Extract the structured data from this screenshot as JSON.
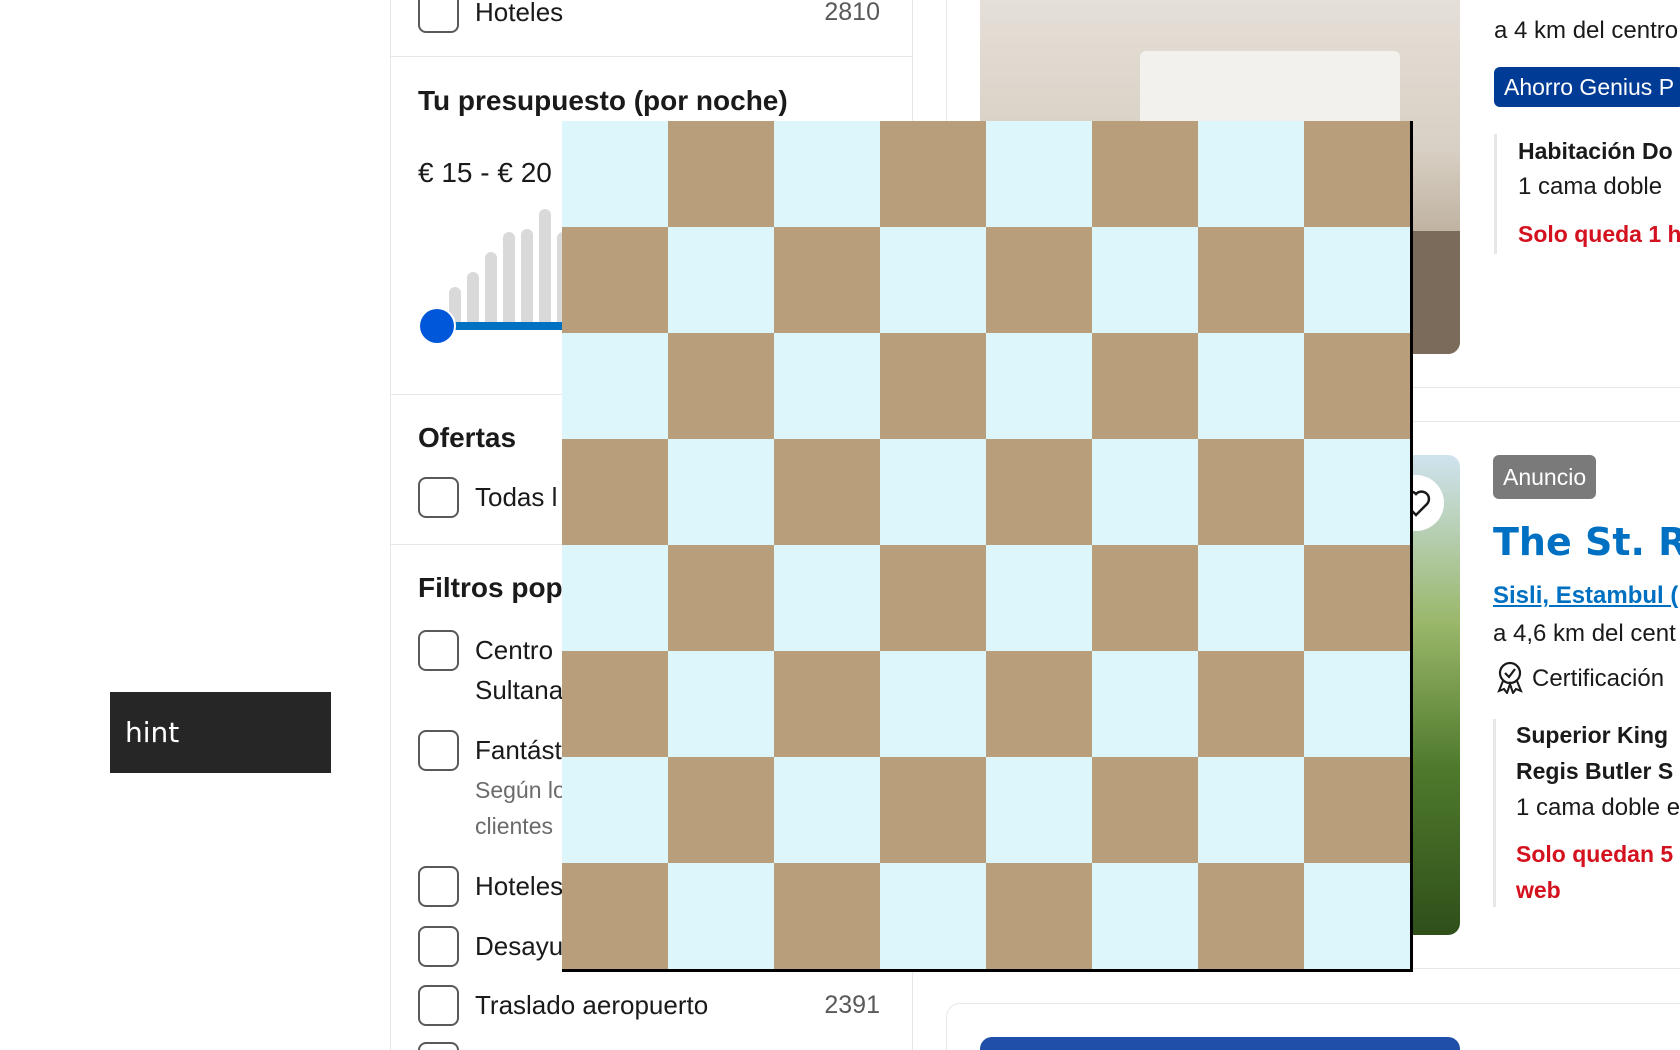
{
  "tooltip": {
    "text": "hint"
  },
  "sidebar": {
    "top_row": {
      "label": "Hoteles",
      "count": "2810"
    },
    "budget": {
      "title": "Tu presupuesto (por noche)",
      "range_label": "€ 15 - € 20"
    },
    "offers": {
      "title": "Ofertas",
      "items": [
        {
          "label": "Todas l"
        }
      ]
    },
    "popular_filters": {
      "title": "Filtros pop",
      "items": [
        {
          "label": "Centro",
          "label_line2": "Sultana"
        },
        {
          "label": "Fantást",
          "sub_line1": "Según lo",
          "sub_line2": "clientes"
        },
        {
          "label": "Hoteles"
        },
        {
          "label": "Desayu"
        },
        {
          "label": "Traslado aeropuerto",
          "count": "2391"
        }
      ]
    }
  },
  "results": {
    "card1": {
      "distance": "a 4 km del centro",
      "genius_badge": "Ahorro Genius P",
      "room_name": "Habitación Do",
      "bed": "1 cama doble",
      "urgency": "Solo queda 1 h"
    },
    "card2": {
      "ad_badge": "Anuncio",
      "hotel_name": "The St. Re",
      "location_link": "Sisli, Estambul (",
      "distance": "a 4,6 km del cent",
      "certification": "Certificación",
      "room_name_line1": "Superior King",
      "room_name_line2": "Regis Butler S",
      "bed": "1 cama doble e",
      "urgency_line1": "Solo quedan 5",
      "urgency_line2": "web"
    }
  },
  "checkerboard": {
    "rows": 8,
    "cols": 8,
    "light_color": "#dcf6fc",
    "dark_color": "#b89e7b"
  }
}
